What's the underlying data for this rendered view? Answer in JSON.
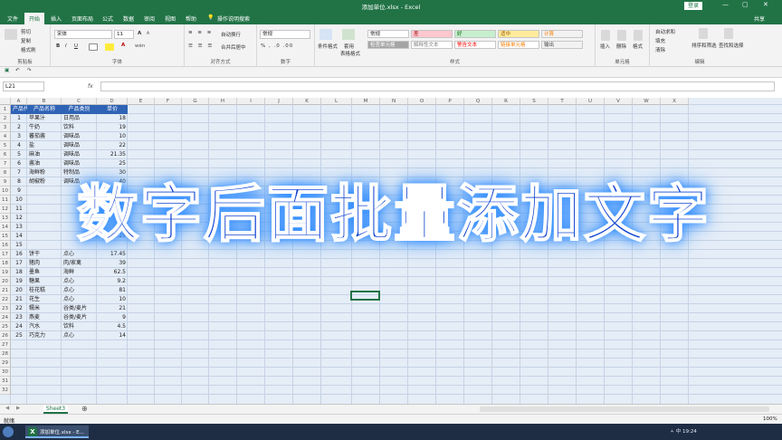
{
  "window": {
    "title": "添加单位.xlsx - Excel",
    "login": "登录",
    "controls": [
      "—",
      "▢",
      "✕"
    ]
  },
  "tabs": [
    "文件",
    "开始",
    "插入",
    "页面布局",
    "公式",
    "数据",
    "审阅",
    "视图",
    "帮助"
  ],
  "active_tab": "开始",
  "tell_me": "操作说明搜索",
  "share": "共享",
  "ribbon": {
    "clipboard": {
      "label": "剪贴板",
      "cut": "剪切",
      "copy": "复制",
      "format_painter": "格式刷"
    },
    "font": {
      "label": "字体",
      "font_name": "宋体",
      "font_size": "11",
      "bold": "B",
      "italic": "I",
      "underline": "U",
      "grow": "A",
      "shrink": "A",
      "text_color": "A",
      "wen": "wén"
    },
    "alignment": {
      "label": "对齐方式",
      "wrap": "自动换行",
      "merge": "合并后居中"
    },
    "number": {
      "label": "数字",
      "format": "常规"
    },
    "styles": {
      "label": "样式",
      "cond": "条件格式",
      "table": "套用",
      "table2": "表格格式",
      "cells": [
        {
          "text": "常规",
          "bg": "#ffffff",
          "fg": "#222222"
        },
        {
          "text": "差",
          "bg": "#ffc7ce",
          "fg": "#9c0006"
        },
        {
          "text": "好",
          "bg": "#c6efce",
          "fg": "#006100"
        },
        {
          "text": "适中",
          "bg": "#ffeb9c",
          "fg": "#9c5700"
        },
        {
          "text": "计算",
          "bg": "#f2f2f2",
          "fg": "#fa7d00"
        },
        {
          "text": "检查单元格",
          "bg": "#a5a5a5",
          "fg": "#ffffff"
        },
        {
          "text": "解释性文本",
          "bg": "#ffffff",
          "fg": "#7f7f7f"
        },
        {
          "text": "警告文本",
          "bg": "#ffffff",
          "fg": "#ff0000"
        },
        {
          "text": "链接单元格",
          "bg": "#ffffff",
          "fg": "#fa7d00"
        },
        {
          "text": "输出",
          "bg": "#f2f2f2",
          "fg": "#3f3f3f"
        }
      ]
    },
    "cells_group": {
      "label": "单元格",
      "insert": "插入",
      "delete": "删除",
      "format": "格式"
    },
    "editing": {
      "label": "编辑",
      "autosum": "自动求和",
      "fill": "填充",
      "clear": "清除",
      "sort": "排序和筛选",
      "find": "查找和选择"
    }
  },
  "name_box": "L21",
  "fx": "fx",
  "columns": [
    "A",
    "B",
    "C",
    "D",
    "E",
    "F",
    "G",
    "H",
    "I",
    "J",
    "K",
    "L",
    "M",
    "N",
    "O",
    "P",
    "Q",
    "R",
    "S",
    "T",
    "U",
    "V",
    "W",
    "X"
  ],
  "row_numbers": [
    "1",
    "2",
    "3",
    "4",
    "5",
    "6",
    "7",
    "8",
    "9",
    "10",
    "11",
    "12",
    "13",
    "14",
    "15",
    "16",
    "17",
    "18",
    "19",
    "20",
    "21",
    "22",
    "23",
    "24",
    "25",
    "26",
    "27",
    "28",
    "29",
    "30",
    "31",
    "32"
  ],
  "table": {
    "headers": [
      "产品代码",
      "产品名称",
      "产品类别",
      "单价"
    ],
    "rows": [
      [
        "1",
        "苹果汁",
        "日用品",
        "18"
      ],
      [
        "2",
        "牛奶",
        "饮料",
        "19"
      ],
      [
        "3",
        "蕃茄酱",
        "调味品",
        "10"
      ],
      [
        "4",
        "盐",
        "调味品",
        "22"
      ],
      [
        "5",
        "麻油",
        "调味品",
        "21.35"
      ],
      [
        "6",
        "酱油",
        "调味品",
        "25"
      ],
      [
        "7",
        "海鲜粉",
        "特制品",
        "30"
      ],
      [
        "8",
        "胡椒粉",
        "调味品",
        "40"
      ],
      [
        "9",
        "",
        "",
        ""
      ],
      [
        "10",
        "",
        "",
        ""
      ],
      [
        "11",
        "",
        "",
        ""
      ],
      [
        "12",
        "",
        "",
        ""
      ],
      [
        "13",
        "",
        "",
        ""
      ],
      [
        "14",
        "",
        "",
        "23.25"
      ],
      [
        "15",
        "",
        "",
        ""
      ],
      [
        "16",
        "饼干",
        "点心",
        "17.45"
      ],
      [
        "17",
        "猪肉",
        "肉/家禽",
        "39"
      ],
      [
        "18",
        "墨鱼",
        "海鲜",
        "62.5"
      ],
      [
        "19",
        "糖果",
        "点心",
        "9.2"
      ],
      [
        "20",
        "桂花糕",
        "点心",
        "81"
      ],
      [
        "21",
        "花生",
        "点心",
        "10"
      ],
      [
        "22",
        "糯米",
        "谷类/麦片",
        "21"
      ],
      [
        "23",
        "燕麦",
        "谷类/麦片",
        "9"
      ],
      [
        "24",
        "汽水",
        "饮料",
        "4.5"
      ],
      [
        "25",
        "巧克力",
        "点心",
        "14"
      ]
    ]
  },
  "overlay_title": "数字后面批量添加文字",
  "sheet_tab": "Sheet3",
  "status": "就绪",
  "zoom": "100%",
  "taskbar": {
    "excel_title": "添加单位.xlsx - E...",
    "xl": "X",
    "tray": "ㅅ  中  19:24"
  }
}
